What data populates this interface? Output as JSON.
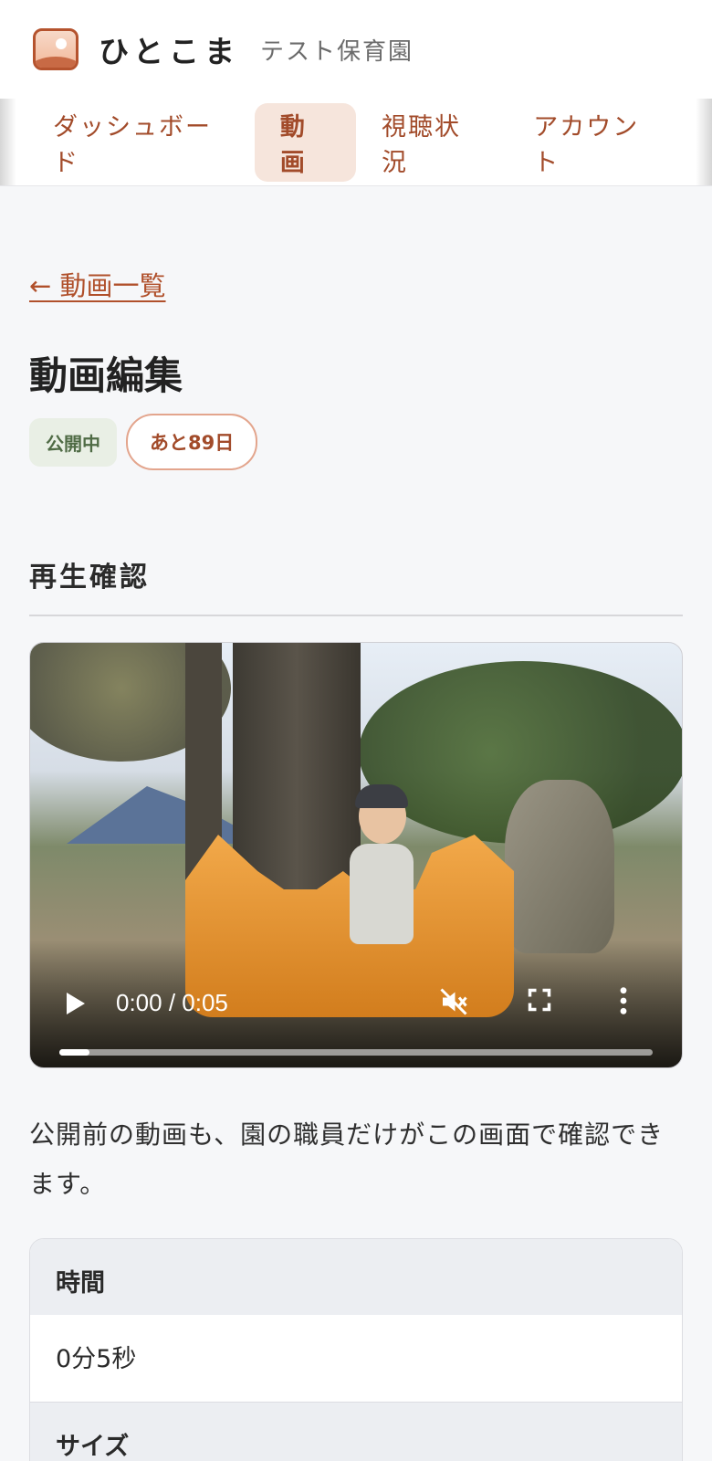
{
  "header": {
    "brand": "ひとこま",
    "organization": "テスト保育園",
    "logo_icon": "photo-icon"
  },
  "nav": {
    "tabs": [
      {
        "label": "ダッシュボード",
        "active": false
      },
      {
        "label": "動画",
        "active": true
      },
      {
        "label": "視聴状況",
        "active": false
      },
      {
        "label": "アカウント",
        "active": false
      }
    ]
  },
  "main": {
    "back_link": "← 動画一覧",
    "title": "動画編集",
    "status_badge": "公開中",
    "days_badge": "あと89日",
    "section_title": "再生確認",
    "note": "公開前の動画も、園の職員だけがこの画面で確認できます。"
  },
  "video": {
    "time": "0:00 / 0:05",
    "progress_fraction": 0.05,
    "muted": true,
    "icons": [
      "play-icon",
      "muted-icon",
      "fullscreen-icon",
      "more-vert-icon"
    ]
  },
  "info": [
    {
      "label": "時間",
      "value": "0分5秒"
    },
    {
      "label": "サイズ",
      "value": ""
    }
  ],
  "colors": {
    "accent": "#b0502b",
    "active_tab_bg": "#f6e5dc",
    "public_badge_bg": "#e9efe5",
    "public_badge_text": "#4f6b45",
    "background": "#f6f7f9"
  }
}
